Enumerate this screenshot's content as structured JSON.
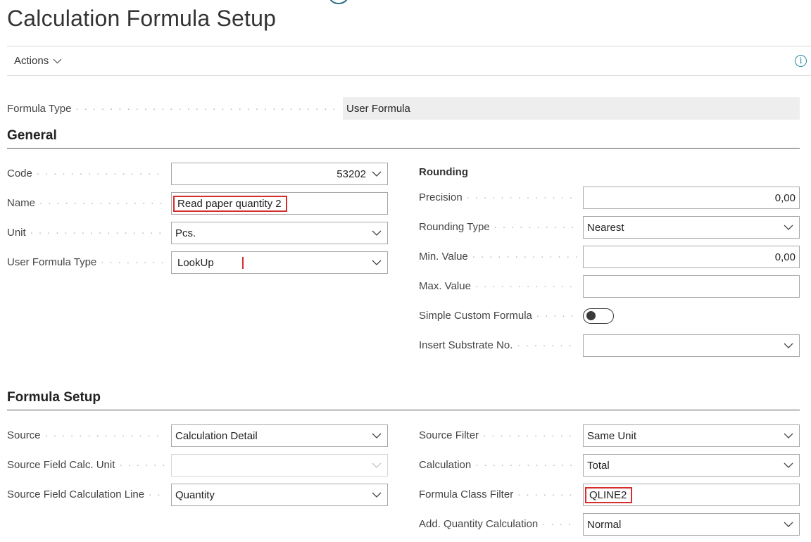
{
  "page": {
    "title": "Calculation Formula Setup"
  },
  "toolbar": {
    "actions_label": "Actions"
  },
  "formula_type": {
    "label": "Formula Type",
    "value": "User Formula"
  },
  "general": {
    "heading": "General",
    "code": {
      "label": "Code",
      "value": "53202"
    },
    "name": {
      "label": "Name",
      "value": "Read paper quantity 2"
    },
    "unit": {
      "label": "Unit",
      "value": "Pcs."
    },
    "user_formula_type": {
      "label": "User Formula Type",
      "value": "LookUp"
    },
    "rounding": {
      "heading": "Rounding",
      "precision": {
        "label": "Precision",
        "value": "0,00"
      },
      "rounding_type": {
        "label": "Rounding Type",
        "value": "Nearest"
      },
      "min_value": {
        "label": "Min. Value",
        "value": "0,00"
      },
      "max_value": {
        "label": "Max. Value",
        "value": ""
      },
      "simple_custom_formula": {
        "label": "Simple Custom Formula",
        "enabled": false
      },
      "insert_substrate_no": {
        "label": "Insert Substrate No.",
        "value": ""
      }
    }
  },
  "formula_setup": {
    "heading": "Formula Setup",
    "source": {
      "label": "Source",
      "value": "Calculation Detail"
    },
    "source_field_calc_unit": {
      "label": "Source Field Calc. Unit",
      "value": ""
    },
    "source_field_calculation_line": {
      "label": "Source Field Calculation Line",
      "value": "Quantity"
    },
    "source_filter": {
      "label": "Source Filter",
      "value": "Same Unit"
    },
    "calculation": {
      "label": "Calculation",
      "value": "Total"
    },
    "formula_class_filter": {
      "label": "Formula Class Filter",
      "value": "QLINE2"
    },
    "add_quantity_calculation": {
      "label": "Add. Quantity Calculation",
      "value": "Normal"
    }
  },
  "icons": {
    "info": "info-icon",
    "chevron": "chevron-down-icon"
  },
  "colors": {
    "highlight": "#d62d2d",
    "readonly_bg": "#eeeeee",
    "accent": "#2a8aa8"
  }
}
